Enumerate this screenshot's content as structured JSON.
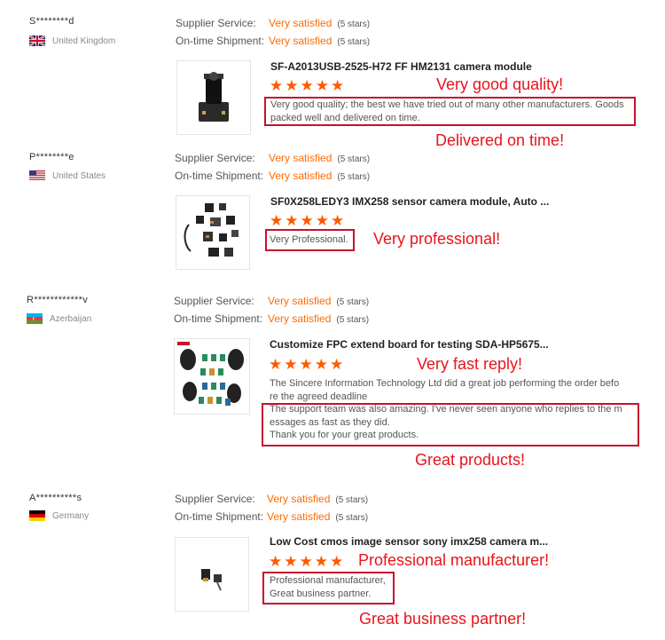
{
  "labels": {
    "supplier_service": "Supplier Service:",
    "on_time_shipment": "On-time Shipment:",
    "rating_value": "Very satisfied",
    "rating_note": "(5 stars)",
    "stars": "★★★★★"
  },
  "reviews": [
    {
      "user": "S********d",
      "country": "United Kingdom",
      "product_title": "SF-A2013USB-2525-H72 FF HM2131 camera module",
      "comment_lines": [
        "Very good quality; the best we have tried out of many other manufacturers. Goods",
        "packed well and delivered on time."
      ],
      "annotations": [
        "Very good quality!",
        "Delivered on time!"
      ]
    },
    {
      "user": "P********e",
      "country": "United States",
      "product_title": "SF0X258LEDY3 IMX258 sensor camera module, Auto ...",
      "comment_lines": [
        "Very Professional."
      ],
      "annotations": [
        "Very professional!"
      ]
    },
    {
      "user": "R************v",
      "country": "Azerbaijan",
      "product_title": "Customize FPC extend board for testing SDA-HP5675...",
      "comment_lines": [
        "The Sincere Information Technology Ltd did a great job performing the order befo",
        "re the agreed deadline",
        "The support team was also amazing. I've never seen anyone who replies to the m",
        "essages as fast as they did.",
        "Thank you for your great products."
      ],
      "annotations": [
        "Very fast reply!",
        "Great products!"
      ]
    },
    {
      "user": "A**********s",
      "country": "Germany",
      "product_title": "Low Cost cmos image sensor sony imx258 camera m...",
      "comment_lines": [
        "Professional manufacturer,",
        "Great business partner."
      ],
      "annotations": [
        "Professional manufacturer!",
        "Great business partner!"
      ]
    }
  ]
}
